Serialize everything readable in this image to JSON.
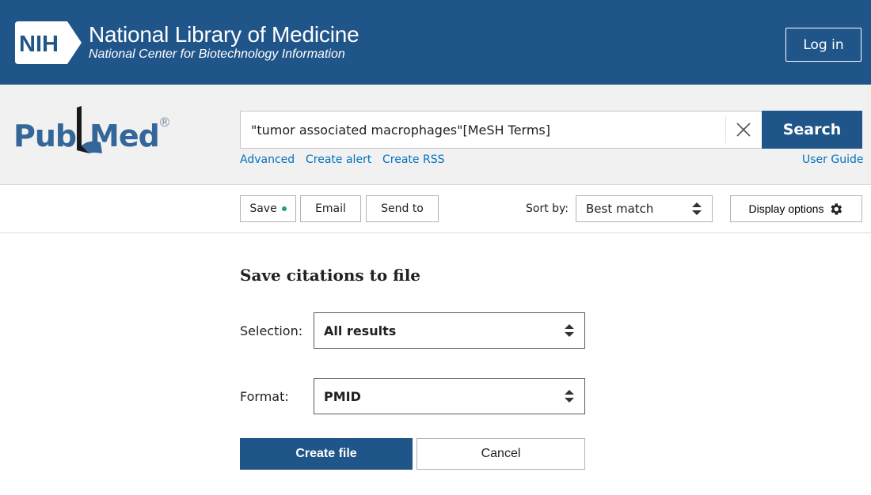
{
  "header": {
    "logo_text": "NIH",
    "title": "National Library of Medicine",
    "subtitle": "National Center for Biotechnology Information",
    "login_label": "Log in",
    "colors": {
      "banner": "#20558a",
      "text": "#ffffff"
    }
  },
  "search": {
    "logo_text": "PubMed",
    "logo_mark": "®",
    "query": "\"tumor associated macrophages\"[MeSH Terms]",
    "clear_icon": "close-icon",
    "button_label": "Search",
    "links": {
      "advanced": "Advanced",
      "create_alert": "Create alert",
      "create_rss": "Create RSS",
      "user_guide": "User Guide"
    },
    "colors": {
      "link": "#0071bc",
      "button": "#20558a"
    }
  },
  "toolbar": {
    "save_label": "Save",
    "email_label": "Email",
    "send_to_label": "Send to",
    "sort_by_label": "Sort by:",
    "sort_value": "Best match",
    "display_options_label": "Display options",
    "save_dot_color": "#18a37a"
  },
  "save_panel": {
    "title": "Save citations to file",
    "selection_label": "Selection:",
    "selection_value": "All results",
    "format_label": "Format:",
    "format_value": "PMID",
    "create_label": "Create file",
    "cancel_label": "Cancel"
  }
}
